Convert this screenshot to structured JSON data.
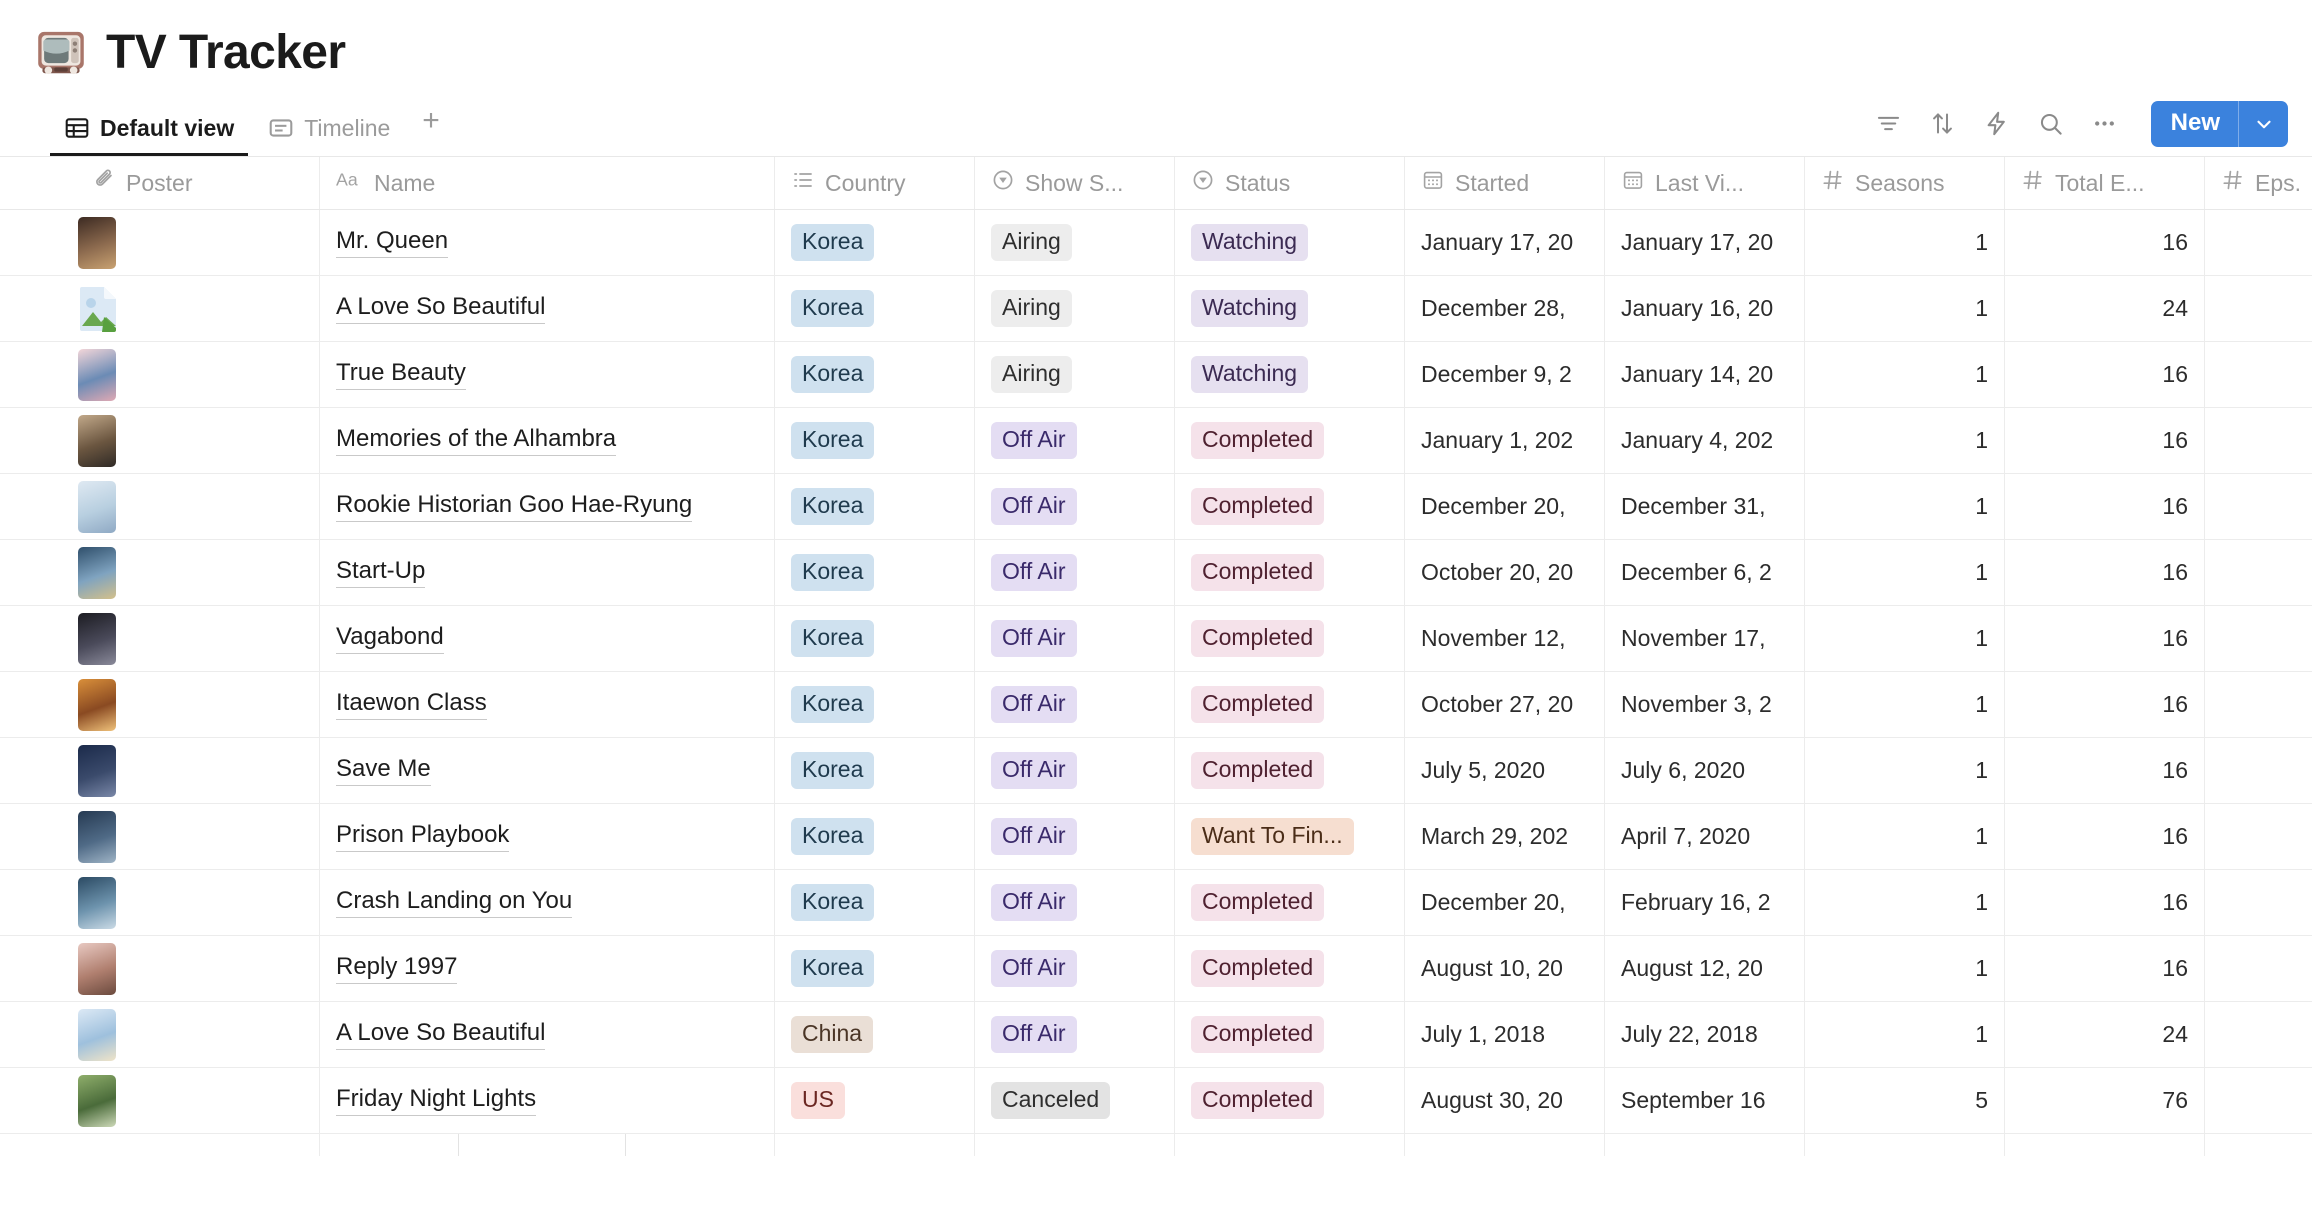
{
  "header": {
    "title": "TV Tracker",
    "emoji_icon": "television-icon"
  },
  "viewbar": {
    "tabs": [
      {
        "label": "Default view",
        "icon": "table-grid-icon",
        "active": true
      },
      {
        "label": "Timeline",
        "icon": "timeline-icon",
        "active": false
      }
    ],
    "add_view_label": "+",
    "toolbar_icons": [
      {
        "name": "filter-icon"
      },
      {
        "name": "sort-icon"
      },
      {
        "name": "automation-lightning-icon"
      },
      {
        "name": "search-icon"
      },
      {
        "name": "more-options-icon"
      }
    ],
    "new_button": {
      "label": "New",
      "caret_icon": "chevron-down-icon",
      "color": "#3b82dd"
    }
  },
  "table": {
    "columns": [
      {
        "key": "poster",
        "label": "Poster",
        "icon": "attachment-paperclip-icon"
      },
      {
        "key": "name",
        "label": "Name",
        "icon": "text-aa-icon"
      },
      {
        "key": "country",
        "label": "Country",
        "icon": "multi-select-icon"
      },
      {
        "key": "show",
        "label": "Show S...",
        "icon": "single-select-icon"
      },
      {
        "key": "status",
        "label": "Status",
        "icon": "single-select-icon"
      },
      {
        "key": "started",
        "label": "Started",
        "icon": "calendar-icon"
      },
      {
        "key": "last",
        "label": "Last Vi...",
        "icon": "calendar-icon"
      },
      {
        "key": "seasons",
        "label": "Seasons",
        "icon": "number-hash-icon"
      },
      {
        "key": "total",
        "label": "Total E...",
        "icon": "number-hash-icon"
      },
      {
        "key": "eps",
        "label": "Eps.",
        "icon": "number-hash-icon"
      }
    ],
    "rows": [
      {
        "poster": "ok",
        "name": "Mr. Queen",
        "country": "Korea",
        "show": "Airing",
        "status": "Watching",
        "started": "January 17, 20",
        "last": "January 17, 20",
        "seasons": "1",
        "total": "16",
        "eps": ""
      },
      {
        "poster": "broken",
        "name": "A Love So Beautiful",
        "country": "Korea",
        "show": "Airing",
        "status": "Watching",
        "started": "December 28,",
        "last": "January 16, 20",
        "seasons": "1",
        "total": "24",
        "eps": ""
      },
      {
        "poster": "ok",
        "name": "True Beauty",
        "country": "Korea",
        "show": "Airing",
        "status": "Watching",
        "started": "December 9, 2",
        "last": "January 14, 20",
        "seasons": "1",
        "total": "16",
        "eps": ""
      },
      {
        "poster": "ok",
        "name": "Memories of the Alhambra",
        "country": "Korea",
        "show": "Off Air",
        "status": "Completed",
        "started": "January 1, 202",
        "last": "January 4, 202",
        "seasons": "1",
        "total": "16",
        "eps": ""
      },
      {
        "poster": "ok",
        "name": "Rookie Historian Goo Hae-Ryung",
        "country": "Korea",
        "show": "Off Air",
        "status": "Completed",
        "started": "December 20,",
        "last": "December 31,",
        "seasons": "1",
        "total": "16",
        "eps": ""
      },
      {
        "poster": "ok",
        "name": "Start-Up",
        "country": "Korea",
        "show": "Off Air",
        "status": "Completed",
        "started": "October 20, 20",
        "last": "December 6, 2",
        "seasons": "1",
        "total": "16",
        "eps": ""
      },
      {
        "poster": "ok",
        "name": "Vagabond",
        "country": "Korea",
        "show": "Off Air",
        "status": "Completed",
        "started": "November 12,",
        "last": "November 17,",
        "seasons": "1",
        "total": "16",
        "eps": ""
      },
      {
        "poster": "ok",
        "name": "Itaewon Class",
        "country": "Korea",
        "show": "Off Air",
        "status": "Completed",
        "started": "October 27, 20",
        "last": "November 3, 2",
        "seasons": "1",
        "total": "16",
        "eps": ""
      },
      {
        "poster": "ok",
        "name": "Save Me",
        "country": "Korea",
        "show": "Off Air",
        "status": "Completed",
        "started": "July 5, 2020",
        "last": "July 6, 2020",
        "seasons": "1",
        "total": "16",
        "eps": ""
      },
      {
        "poster": "ok",
        "name": "Prison Playbook",
        "country": "Korea",
        "show": "Off Air",
        "status": "Want To Fin...",
        "started": "March 29, 202",
        "last": "April 7, 2020",
        "seasons": "1",
        "total": "16",
        "eps": ""
      },
      {
        "poster": "ok",
        "name": "Crash Landing on You",
        "country": "Korea",
        "show": "Off Air",
        "status": "Completed",
        "started": "December 20,",
        "last": "February 16, 2",
        "seasons": "1",
        "total": "16",
        "eps": ""
      },
      {
        "poster": "ok",
        "name": "Reply 1997",
        "country": "Korea",
        "show": "Off Air",
        "status": "Completed",
        "started": "August 10, 20",
        "last": "August 12, 20",
        "seasons": "1",
        "total": "16",
        "eps": ""
      },
      {
        "poster": "ok",
        "name": "A Love So Beautiful",
        "country": "China",
        "show": "Off Air",
        "status": "Completed",
        "started": "July 1, 2018",
        "last": "July 22, 2018",
        "seasons": "1",
        "total": "24",
        "eps": ""
      },
      {
        "poster": "ok",
        "name": "Friday Night Lights",
        "country": "US",
        "show": "Canceled",
        "status": "Completed",
        "started": "August 30, 20",
        "last": "September 16",
        "seasons": "5",
        "total": "76",
        "eps": ""
      }
    ]
  },
  "tag_colors": {
    "Korea": {
      "bg": "#cfe1ef",
      "fg": "#1f3a4d"
    },
    "China": {
      "bg": "#eadfd6",
      "fg": "#4a3526"
    },
    "US": {
      "bg": "#fadfdc",
      "fg": "#6b2722"
    },
    "Airing": {
      "bg": "#ededed",
      "fg": "#2e2e2e"
    },
    "Off Air": {
      "bg": "#e4ddf3",
      "fg": "#3a2a6b"
    },
    "Canceled": {
      "bg": "#e3e3e3",
      "fg": "#2e2e2e"
    },
    "Watching": {
      "bg": "#e6e0f0",
      "fg": "#3b2a52"
    },
    "Completed": {
      "bg": "#f5e2ea",
      "fg": "#4f2130"
    },
    "Want To Fin...": {
      "bg": "#f6ded0",
      "fg": "#4a2c17"
    }
  },
  "poster_palettes": [
    [
      "#3c2a22",
      "#8c6a4e",
      "#c9a271"
    ],
    [
      "#d9e6f2",
      "#9fc3e0",
      "#6aa84f"
    ],
    [
      "#f3d6d9",
      "#6b8bb5",
      "#e0a9b4"
    ],
    [
      "#c2a98a",
      "#6b5640",
      "#2f2a26"
    ],
    [
      "#dfe9f2",
      "#b8cfe0",
      "#8fa9c4"
    ],
    [
      "#2f4f6b",
      "#7fa3c0",
      "#d4c08a"
    ],
    [
      "#1c1c22",
      "#4a4a5a",
      "#8a8a9a"
    ],
    [
      "#d98f3a",
      "#8a4a22",
      "#f0c27b"
    ],
    [
      "#1b2a4a",
      "#3a4a6b",
      "#7a88a8"
    ],
    [
      "#263a52",
      "#4f6a86",
      "#9fb4c6"
    ],
    [
      "#2b4a63",
      "#6d93ad",
      "#cbdbe6"
    ],
    [
      "#e8c9c2",
      "#b07f6f",
      "#6b4a3e"
    ],
    [
      "#dce9f5",
      "#9ec0dd",
      "#f0e4c8"
    ],
    [
      "#8fae6b",
      "#4a6b3a",
      "#cdd9b8"
    ]
  ]
}
